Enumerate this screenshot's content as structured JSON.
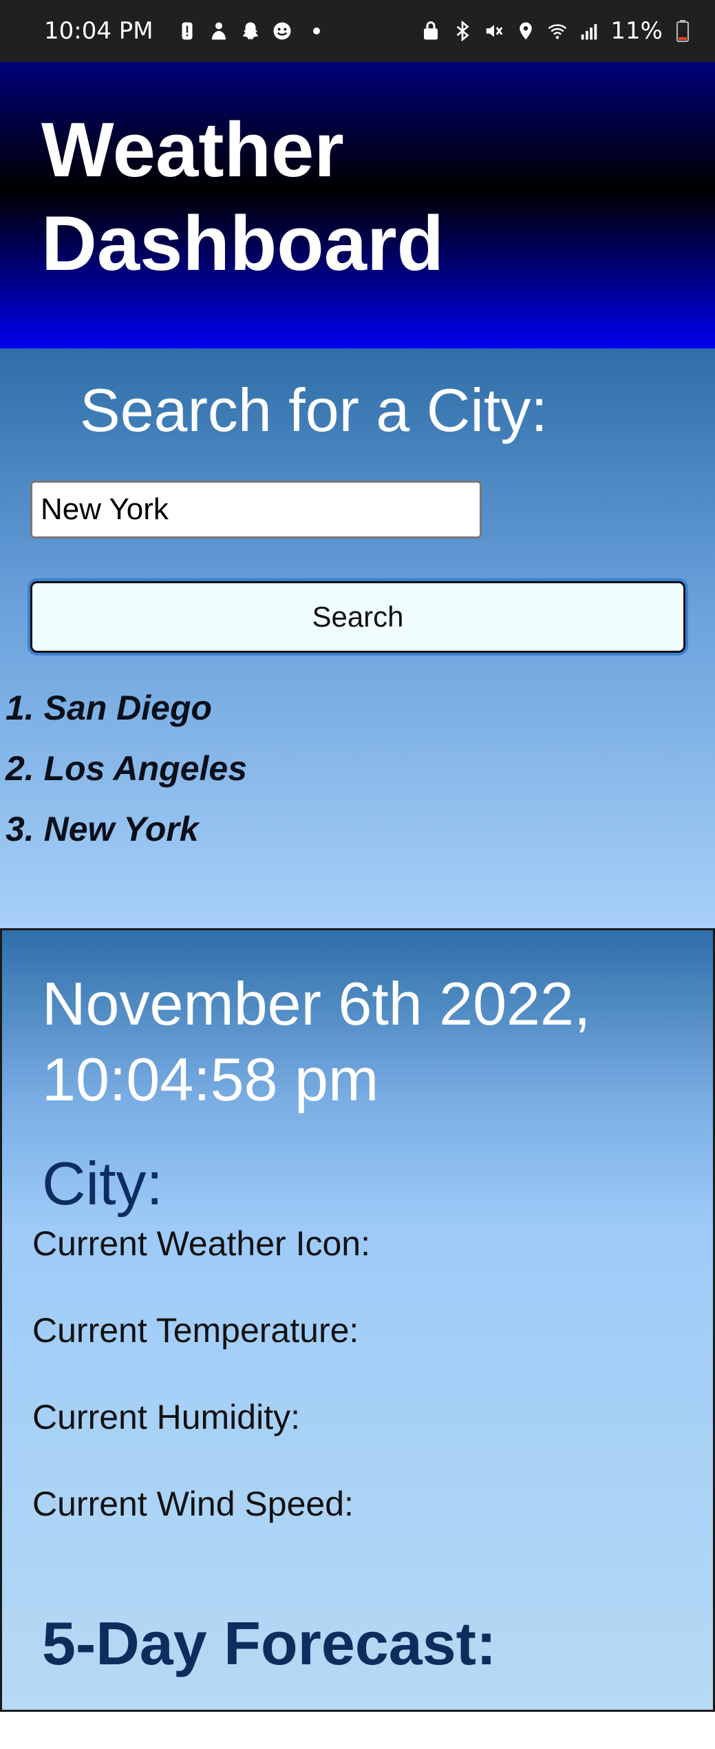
{
  "status_bar": {
    "time": "10:04 PM",
    "battery": "11%",
    "left_icons": [
      "alert-icon",
      "person-icon",
      "snapchat-icon",
      "smiley-icon"
    ],
    "right_icons": [
      "vpn-icon",
      "bluetooth-icon",
      "mute-icon",
      "location-icon",
      "wifi-icon",
      "signal-icon"
    ]
  },
  "header": {
    "title": "Weather Dashboard"
  },
  "search": {
    "heading": "Search for a City:",
    "input_value": "New York",
    "button_label": "Search",
    "history": [
      "1. San Diego",
      "2. Los Angeles",
      "3. New York"
    ]
  },
  "current": {
    "datetime": "November 6th 2022, 10:04:58 pm",
    "city_label": "City:",
    "icon_label": "Current Weather Icon:",
    "temp_label": "Current Temperature:",
    "humidity_label": "Current Humidity:",
    "wind_label": "Current Wind Speed:",
    "forecast_heading": "5-Day Forecast:"
  },
  "colors": {
    "header_top": "#00007a",
    "header_mid": "#000000",
    "header_bottom": "#0000f0",
    "panel_top": "#2f6ea8",
    "panel_bottom": "#b6daf4",
    "heading_dark": "#0d2d5e",
    "button_bg": "#f0fdff"
  }
}
